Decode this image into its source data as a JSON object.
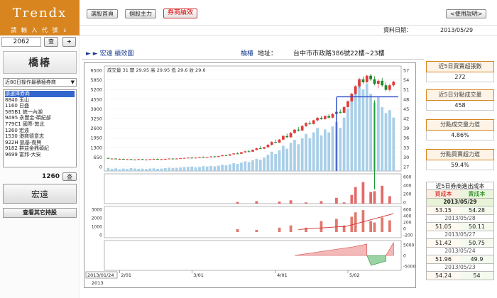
{
  "app": {
    "logo": "Trendx"
  },
  "toolbar": {
    "buttons": [
      "選股首頁",
      "個股主力",
      "券商績效"
    ],
    "help": "<使用說明>"
  },
  "data_date": {
    "label": "資料日期：",
    "value": "2013/05/29"
  },
  "left": {
    "code_header": "請 輸 入 代 號 ↓",
    "code_value": "2062",
    "query_btn": "查",
    "add_btn": "+",
    "stock_name": "橋椿",
    "range_select": "近80日操作最積極券商",
    "brokers": [
      "請選擇券商",
      "8840  玉山",
      "1160  日盛",
      "585B1 統一內湖",
      "9A95  永豐金-碩紀部",
      "779C1 國票-敦北",
      "1260  宏遠",
      "1530  港商德意志",
      "922H  凱基-復興",
      "9182  群益金鼎碩紀",
      "9699  富邦-大安"
    ],
    "broker_code": "1260",
    "broker_query": "查",
    "broker_name": "宏遠",
    "view_other": "查看其它持股"
  },
  "chart_header": {
    "broker": "►  ►  宏遠   績效圖",
    "stock": "橋椿",
    "address_label": "地址：",
    "address": "台中市市政路386號22樓~23樓"
  },
  "legend": "成交量 31  開 29.95  高 29.95  低 29.6  收 29.6",
  "chart_data": {
    "type": "candlestick",
    "x_ticks": [
      "2013/01/24",
      "2/01",
      "3/01",
      "4/01",
      "5/02"
    ],
    "x_sub": "2013",
    "volume_ticks": [
      "6500",
      "5850",
      "5200",
      "4550",
      "3900",
      "3250",
      "2600",
      "1950",
      "1300",
      "650",
      "0"
    ],
    "price_ticks": [
      "57",
      "54",
      "51",
      "48",
      "45",
      "42",
      "39",
      "36",
      "33",
      "30",
      "27"
    ],
    "ylim_price": [
      27,
      59
    ],
    "ylim_volume": [
      0,
      6500
    ],
    "candles": [
      [
        29.9,
        29.9,
        29.6,
        29.7
      ],
      [
        29.7,
        29.8,
        29.6,
        29.7
      ],
      [
        29.7,
        29.8,
        29.6,
        29.6
      ],
      [
        29.6,
        29.7,
        29.5,
        29.6
      ],
      [
        29.6,
        29.7,
        29.5,
        29.5
      ],
      [
        29.5,
        29.6,
        29.4,
        29.5
      ],
      [
        29.5,
        29.6,
        29.3,
        29.4
      ],
      [
        29.4,
        29.5,
        29.3,
        29.4
      ],
      [
        29.4,
        29.6,
        29.3,
        29.5
      ],
      [
        29.5,
        29.6,
        29.4,
        29.4
      ],
      [
        29.4,
        29.5,
        29.3,
        29.4
      ],
      [
        29.4,
        29.6,
        29.3,
        29.5
      ],
      [
        29.5,
        29.7,
        29.4,
        29.6
      ],
      [
        29.6,
        29.7,
        29.5,
        29.5
      ],
      [
        29.5,
        29.6,
        29.4,
        29.5
      ],
      [
        29.5,
        29.7,
        29.4,
        29.6
      ],
      [
        29.6,
        29.8,
        29.5,
        29.7
      ],
      [
        29.7,
        29.8,
        29.5,
        29.6
      ],
      [
        29.6,
        29.8,
        29.5,
        29.7
      ],
      [
        29.7,
        29.9,
        29.6,
        29.8
      ],
      [
        29.8,
        30.0,
        29.7,
        29.9
      ],
      [
        29.9,
        30.1,
        29.8,
        30.0
      ],
      [
        30.0,
        30.2,
        29.8,
        29.9
      ],
      [
        29.9,
        30.1,
        29.8,
        30.0
      ],
      [
        30.0,
        30.3,
        29.9,
        30.2
      ],
      [
        30.2,
        30.4,
        30.0,
        30.1
      ],
      [
        30.1,
        30.3,
        30.0,
        30.2
      ],
      [
        30.2,
        30.5,
        30.1,
        30.4
      ],
      [
        30.4,
        30.6,
        30.2,
        30.3
      ],
      [
        30.3,
        30.6,
        30.2,
        30.5
      ],
      [
        30.5,
        30.9,
        30.4,
        30.8
      ],
      [
        30.8,
        31.0,
        30.6,
        30.7
      ],
      [
        30.7,
        31.2,
        30.6,
        31.1
      ],
      [
        31.1,
        31.5,
        31.0,
        31.4
      ],
      [
        31.4,
        31.8,
        31.2,
        31.3
      ],
      [
        31.3,
        31.9,
        31.2,
        31.8
      ],
      [
        31.8,
        32.3,
        31.6,
        32.1
      ],
      [
        32.1,
        32.6,
        31.9,
        32.0
      ],
      [
        32.0,
        32.8,
        31.9,
        32.6
      ],
      [
        32.6,
        33.3,
        32.4,
        33.1
      ],
      [
        33.1,
        33.8,
        32.9,
        33.0
      ],
      [
        33.0,
        33.6,
        32.8,
        33.5
      ],
      [
        33.5,
        34.5,
        33.3,
        34.3
      ],
      [
        34.3,
        35.5,
        34.0,
        35.2
      ],
      [
        35.2,
        36.0,
        34.8,
        35.0
      ],
      [
        35.0,
        36.2,
        34.9,
        36.0
      ],
      [
        36.0,
        37.5,
        35.8,
        37.2
      ],
      [
        37.2,
        38.0,
        36.5,
        36.8
      ],
      [
        36.8,
        38.5,
        36.6,
        38.2
      ],
      [
        38.2,
        39.5,
        38.0,
        39.3
      ],
      [
        39.3,
        40.2,
        38.7,
        39.0
      ],
      [
        39.0,
        40.8,
        38.9,
        40.5
      ],
      [
        40.5,
        41.8,
        40.2,
        41.5
      ],
      [
        41.5,
        42.3,
        40.9,
        41.2
      ],
      [
        41.2,
        42.6,
        41.0,
        42.4
      ],
      [
        42.4,
        43.5,
        42.0,
        43.2
      ],
      [
        43.2,
        43.8,
        42.6,
        42.8
      ],
      [
        42.8,
        44.0,
        42.6,
        43.8
      ],
      [
        43.8,
        44.5,
        43.0,
        43.3
      ],
      [
        43.3,
        44.8,
        43.1,
        44.5
      ],
      [
        44.5,
        45.5,
        44.0,
        45.2
      ],
      [
        45.2,
        46.0,
        44.6,
        44.9
      ],
      [
        44.9,
        47.0,
        44.8,
        46.8
      ],
      [
        46.8,
        49.0,
        46.5,
        48.7
      ],
      [
        48.7,
        51.5,
        48.5,
        51.2
      ],
      [
        51.2,
        54.0,
        50.8,
        53.7
      ],
      [
        53.7,
        56.5,
        53.0,
        56.0
      ],
      [
        56.0,
        57.0,
        54.5,
        55.0
      ],
      [
        55.0,
        57.5,
        54.8,
        57.2
      ],
      [
        57.2,
        57.8,
        55.5,
        56.0
      ],
      [
        56.0,
        57.0,
        54.0,
        54.5
      ],
      [
        54.5,
        56.0,
        53.0,
        55.5
      ],
      [
        55.5,
        56.5,
        53.5,
        54.0
      ],
      [
        54.0,
        55.0,
        52.0,
        52.5
      ],
      [
        52.5,
        54.5,
        52.0,
        54.0
      ],
      [
        54.0,
        55.5,
        53.5,
        55.2
      ]
    ],
    "volume": [
      200,
      150,
      180,
      120,
      160,
      140,
      190,
      170,
      150,
      160,
      140,
      170,
      180,
      150,
      160,
      190,
      220,
      200,
      210,
      240,
      260,
      280,
      300,
      250,
      270,
      320,
      300,
      340,
      310,
      360,
      420,
      380,
      450,
      520,
      480,
      560,
      650,
      600,
      720,
      820,
      760,
      900,
      1100,
      1300,
      1150,
      1400,
      1700,
      1500,
      1900,
      2100,
      1800,
      2200,
      2500,
      2200,
      2600,
      2900,
      2400,
      2800,
      2600,
      3000,
      3300,
      2900,
      3600,
      4200,
      4800,
      5600,
      6200,
      5500,
      5900,
      5200,
      4600,
      5000,
      4300,
      3900,
      4100,
      3600
    ],
    "buy_sell_ticks": [
      "600",
      "400",
      "200",
      "0"
    ],
    "cumulative_ticks": [
      "3000",
      "2000",
      "1000",
      "0"
    ],
    "cumulative_right_ticks": [
      "600",
      "400",
      "200",
      "0",
      "-200"
    ],
    "pnl_ticks": [
      "5000",
      "0",
      "-5000"
    ]
  },
  "right": {
    "boxes": [
      {
        "title": "近5日買賣超張數",
        "value": "272"
      },
      {
        "title": "近5日分點成交量",
        "value": "458"
      },
      {
        "title": "分點成交量力道",
        "value": "4.86%"
      },
      {
        "title": "分點買賣超力道",
        "value": "59.4%"
      }
    ],
    "cost_title": "近5日券商進出成本",
    "buy_label": "買成本",
    "sell_label": "賣成本",
    "rows": [
      {
        "date": "2013/05/29",
        "buy": "53.15",
        "sell": "54.28"
      },
      {
        "date": "2013/05/28",
        "buy": "51.05",
        "sell": "50.11"
      },
      {
        "date": "2013/05/27",
        "buy": "51.42",
        "sell": "50.75"
      },
      {
        "date": "2013/05/24",
        "buy": "51.96",
        "sell": "49.9"
      },
      {
        "date": "2013/05/23",
        "buy": "54.24",
        "sell": "54"
      }
    ]
  }
}
